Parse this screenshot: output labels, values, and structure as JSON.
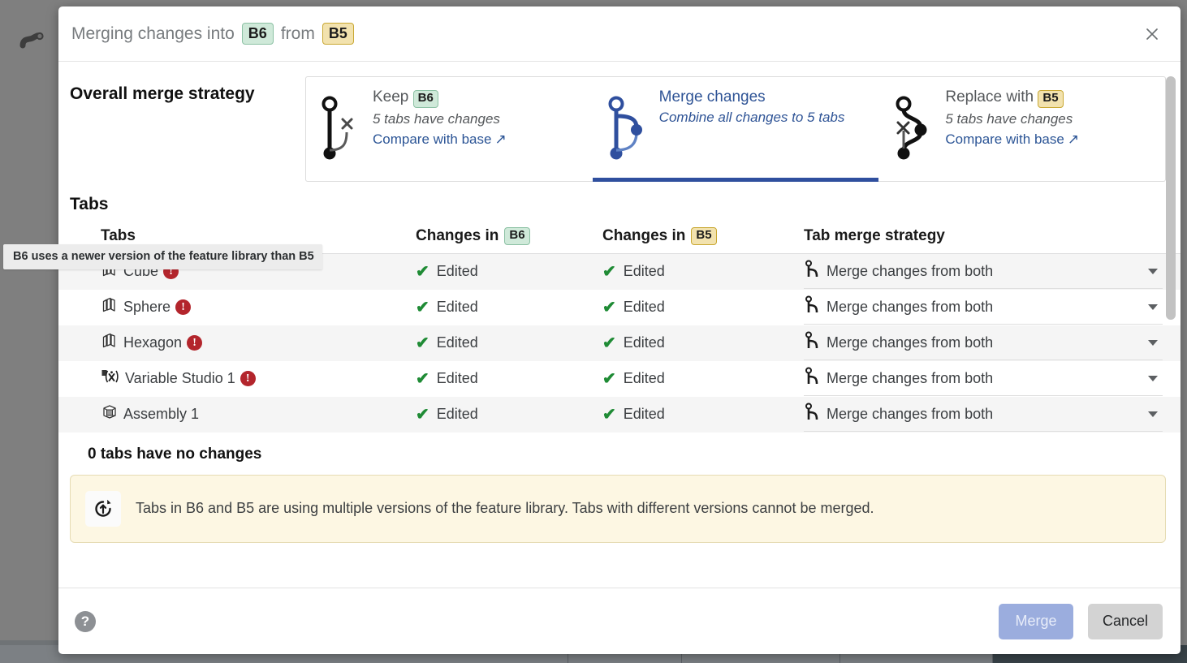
{
  "header": {
    "title_prefix": "Merging changes into",
    "target_branch": "B6",
    "title_mid": "from",
    "source_branch": "B5",
    "close_icon": "close-icon"
  },
  "strategy": {
    "section_label": "Overall merge strategy",
    "options": [
      {
        "id": "keep",
        "title_prefix": "Keep",
        "chip": "B6",
        "chip_color": "green",
        "subtitle": "5 tabs have changes",
        "link": "Compare with base",
        "link_icon": "↗",
        "selected": false
      },
      {
        "id": "merge",
        "title_prefix": "Merge changes",
        "chip": "",
        "chip_color": "none",
        "subtitle": "Combine all changes to 5 tabs",
        "link": "",
        "link_icon": "",
        "selected": true
      },
      {
        "id": "replace",
        "title_prefix": "Replace with",
        "chip": "B5",
        "chip_color": "gold",
        "subtitle": "5 tabs have changes",
        "link": "Compare with base",
        "link_icon": "↗",
        "selected": false
      }
    ]
  },
  "tabs_section": {
    "heading": "Tabs",
    "columns": {
      "name": "Tabs",
      "changes_a_prefix": "Changes in",
      "changes_a_chip": "B6",
      "changes_b_prefix": "Changes in",
      "changes_b_chip": "B5",
      "strategy": "Tab merge strategy"
    },
    "rows": [
      {
        "icon": "part-studio-icon",
        "name": "Cube",
        "has_warning": true,
        "warning_glyph": "!",
        "changes_a": "Edited",
        "changes_b": "Edited",
        "merge_strategy": "Merge changes from both"
      },
      {
        "icon": "part-studio-icon",
        "name": "Sphere",
        "has_warning": true,
        "warning_glyph": "!",
        "changes_a": "Edited",
        "changes_b": "Edited",
        "merge_strategy": "Merge changes from both"
      },
      {
        "icon": "part-studio-icon",
        "name": "Hexagon",
        "has_warning": true,
        "warning_glyph": "!",
        "changes_a": "Edited",
        "changes_b": "Edited",
        "merge_strategy": "Merge changes from both"
      },
      {
        "icon": "variable-studio-icon",
        "name": "Variable Studio 1",
        "has_warning": true,
        "warning_glyph": "!",
        "changes_a": "Edited",
        "changes_b": "Edited",
        "merge_strategy": "Merge changes from both"
      },
      {
        "icon": "assembly-icon",
        "name": "Assembly 1",
        "has_warning": false,
        "warning_glyph": "",
        "changes_a": "Edited",
        "changes_b": "Edited",
        "merge_strategy": "Merge changes from both"
      }
    ],
    "no_changes_line": "0 tabs have no changes"
  },
  "notice": {
    "icon": "update-version-icon",
    "text": "Tabs in B6 and B5 are using multiple versions of the feature library. Tabs with different versions cannot be merged."
  },
  "tooltip": {
    "text": "B6 uses a newer version of the feature library than B5"
  },
  "footer": {
    "help_label": "?",
    "merge_label": "Merge",
    "cancel_label": "Cancel"
  },
  "colors": {
    "accent_blue": "#2f5496",
    "selected_underline": "#2f4f9e",
    "branch_green": "#cfe9d9",
    "branch_gold": "#f2e2ae",
    "warning_red": "#b3252c",
    "check_green": "#1f8b35",
    "notice_bg": "#fdf7e3",
    "merge_button": "#9badde",
    "cancel_button": "#d3d3d3"
  }
}
